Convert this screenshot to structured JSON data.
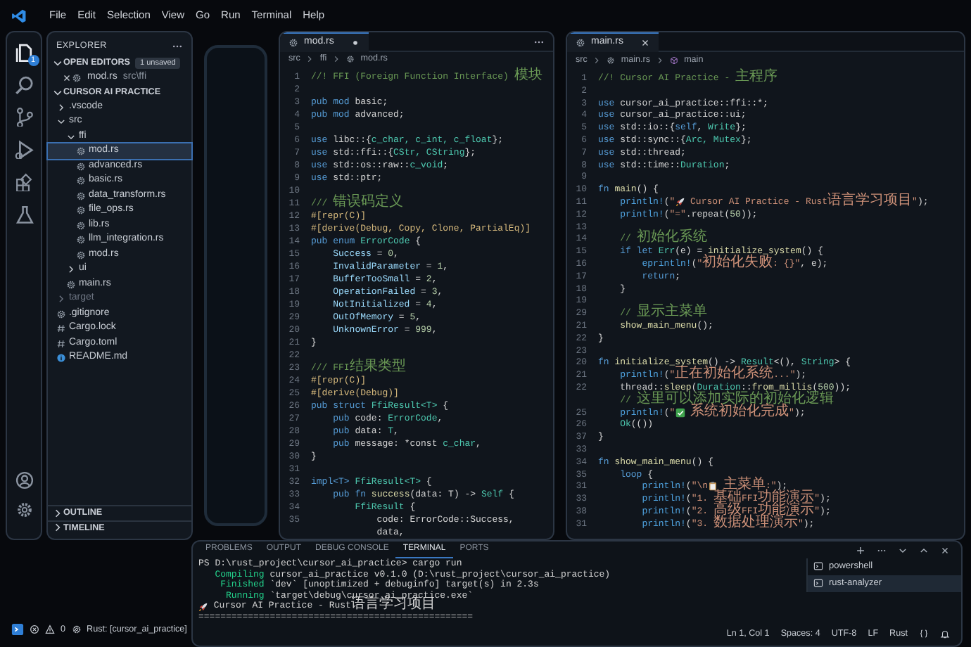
{
  "menu": [
    "File",
    "Edit",
    "Selection",
    "View",
    "Go",
    "Run",
    "Terminal",
    "Help"
  ],
  "activity_bar": {
    "items": [
      {
        "kind": "explorer",
        "selected": true,
        "badge": "1"
      },
      {
        "kind": "search",
        "selected": false
      },
      {
        "kind": "source_control",
        "selected": false
      },
      {
        "kind": "run",
        "selected": false
      },
      {
        "kind": "extensions",
        "selected": false
      },
      {
        "kind": "testing",
        "selected": false
      }
    ],
    "bottom": [
      {
        "kind": "account"
      },
      {
        "kind": "settings"
      }
    ]
  },
  "sidebar": {
    "title": "EXPLORER",
    "open_editors": {
      "title": "OPEN EDITORS",
      "expanded": true,
      "badge": "1 unsaved",
      "items": [
        {
          "label": "mod.rs",
          "path": "src\\ffi",
          "kind": "rust"
        }
      ]
    },
    "project": {
      "title": "CURSOR AI PRACTICE",
      "expanded": true,
      "tree": [
        {
          "label": ".vscode",
          "kind": "folder",
          "expanded": false,
          "selected": false,
          "dimmed": false
        },
        {
          "label": "src",
          "kind": "folder",
          "expanded": true,
          "selected": false,
          "dimmed": false,
          "children": [
            {
              "label": "ffi",
              "kind": "folder",
              "expanded": true,
              "selected": false,
              "dimmed": false,
              "children": [
                {
                  "label": "mod.rs",
                  "kind": "rust",
                  "selected": true,
                  "dimmed": false
                },
                {
                  "label": "advanced.rs",
                  "kind": "rust",
                  "selected": false,
                  "dimmed": false
                },
                {
                  "label": "basic.rs",
                  "kind": "rust",
                  "selected": false,
                  "dimmed": false
                },
                {
                  "label": "data_transform.rs",
                  "kind": "rust",
                  "selected": false,
                  "dimmed": false
                },
                {
                  "label": "file_ops.rs",
                  "kind": "rust",
                  "selected": false,
                  "dimmed": false
                },
                {
                  "label": "lib.rs",
                  "kind": "rust",
                  "selected": false,
                  "dimmed": false
                },
                {
                  "label": "llm_integration.rs",
                  "kind": "rust",
                  "selected": false,
                  "dimmed": false
                },
                {
                  "label": "mod.rs",
                  "kind": "rust",
                  "selected": false,
                  "dimmed": false
                }
              ]
            },
            {
              "label": "ui",
              "kind": "folder",
              "expanded": false,
              "selected": false,
              "dimmed": false
            },
            {
              "label": "main.rs",
              "kind": "rust",
              "selected": false,
              "dimmed": false
            }
          ]
        },
        {
          "label": "target",
          "kind": "folder",
          "expanded": false,
          "selected": false,
          "dimmed": true
        },
        {
          "label": ".gitignore",
          "kind": "git",
          "selected": false,
          "dimmed": false
        },
        {
          "label": "Cargo.lock",
          "kind": "config",
          "selected": false,
          "dimmed": false
        },
        {
          "label": "Cargo.toml",
          "kind": "config",
          "selected": false,
          "dimmed": false
        },
        {
          "label": "README.md",
          "kind": "markdown",
          "selected": false,
          "dimmed": false
        }
      ]
    },
    "sections": [
      {
        "title": "OUTLINE",
        "expanded": false
      },
      {
        "title": "TIMELINE",
        "expanded": false
      }
    ]
  },
  "editors": [
    {
      "tab": {
        "label": "mod.rs",
        "unsaved": true
      },
      "show_more": true,
      "breadcrumb": [
        {
          "label": "src",
          "kind": "folder"
        },
        {
          "label": "ffi",
          "kind": "folder"
        },
        {
          "label": "mod.rs",
          "kind": "rust"
        }
      ],
      "lines": [
        {
          "n": "1",
          "code": [
            {
              "kind": "comment",
              "t": "//! FFI (Foreign Function Interface) 模块"
            }
          ]
        },
        {
          "n": "2"
        },
        {
          "n": "3",
          "code": [
            {
              "kind": "kw",
              "t": "pub mod"
            },
            {
              "kind": "plain",
              "t": " basic;"
            }
          ]
        },
        {
          "n": "4",
          "code": [
            {
              "kind": "kw",
              "t": "pub mod"
            },
            {
              "kind": "plain",
              "t": " advanced;"
            }
          ]
        },
        {
          "n": "5"
        },
        {
          "n": "6",
          "code": [
            {
              "kind": "kw",
              "t": "use"
            },
            {
              "kind": "plain",
              "t": " libc::{"
            },
            {
              "kind": "type",
              "t": "c_char, c_int, c_float"
            },
            {
              "kind": "plain",
              "t": "};"
            }
          ]
        },
        {
          "n": "7",
          "code": [
            {
              "kind": "kw",
              "t": "use"
            },
            {
              "kind": "plain",
              "t": " std::ffi::{"
            },
            {
              "kind": "type",
              "t": "CStr, CString"
            },
            {
              "kind": "plain",
              "t": "};"
            }
          ]
        },
        {
          "n": "8",
          "code": [
            {
              "kind": "kw",
              "t": "use"
            },
            {
              "kind": "plain",
              "t": " std::os::raw::"
            },
            {
              "kind": "type",
              "t": "c_void"
            },
            {
              "kind": "plain",
              "t": ";"
            }
          ]
        },
        {
          "n": "9",
          "code": [
            {
              "kind": "kw",
              "t": "use"
            },
            {
              "kind": "plain",
              "t": " std::ptr;"
            }
          ]
        },
        {
          "n": "10"
        },
        {
          "n": "11",
          "code": [
            {
              "kind": "comment",
              "t": "/// 错误码定义"
            }
          ]
        },
        {
          "n": "12",
          "code": [
            {
              "kind": "attr",
              "t": "#[repr(C)]"
            }
          ]
        },
        {
          "n": "13",
          "code": [
            {
              "kind": "attr",
              "t": "#[derive(Debug, Copy, Clone, PartialEq)]"
            }
          ]
        },
        {
          "n": "14",
          "code": [
            {
              "kind": "kw",
              "t": "pub enum"
            },
            {
              "kind": "type",
              "t": " ErrorCode"
            },
            {
              "kind": "plain",
              "t": " {"
            }
          ]
        },
        {
          "n": "15",
          "code": [
            {
              "kind": "var",
              "t": "    Success"
            },
            {
              "kind": "plain",
              "t": " = "
            },
            {
              "kind": "num",
              "t": "0"
            },
            {
              "kind": "plain",
              "t": ","
            }
          ]
        },
        {
          "n": "16",
          "code": [
            {
              "kind": "var",
              "t": "    InvalidParameter"
            },
            {
              "kind": "plain",
              "t": " = "
            },
            {
              "kind": "num",
              "t": "1"
            },
            {
              "kind": "plain",
              "t": ","
            }
          ]
        },
        {
          "n": "17",
          "code": [
            {
              "kind": "var",
              "t": "    BufferTooSmall"
            },
            {
              "kind": "plain",
              "t": " = "
            },
            {
              "kind": "num",
              "t": "2"
            },
            {
              "kind": "plain",
              "t": ","
            }
          ]
        },
        {
          "n": "18",
          "code": [
            {
              "kind": "var",
              "t": "    OperationFailed"
            },
            {
              "kind": "plain",
              "t": " = "
            },
            {
              "kind": "num",
              "t": "3"
            },
            {
              "kind": "plain",
              "t": ","
            }
          ]
        },
        {
          "n": "19",
          "code": [
            {
              "kind": "var",
              "t": "    NotInitialized"
            },
            {
              "kind": "plain",
              "t": " = "
            },
            {
              "kind": "num",
              "t": "4"
            },
            {
              "kind": "plain",
              "t": ","
            }
          ]
        },
        {
          "n": "29",
          "code": [
            {
              "kind": "var",
              "t": "    OutOfMemory"
            },
            {
              "kind": "plain",
              "t": " = "
            },
            {
              "kind": "num",
              "t": "5"
            },
            {
              "kind": "plain",
              "t": ","
            }
          ]
        },
        {
          "n": "20",
          "code": [
            {
              "kind": "var",
              "t": "    UnknownError"
            },
            {
              "kind": "plain",
              "t": " = "
            },
            {
              "kind": "num",
              "t": "999"
            },
            {
              "kind": "plain",
              "t": ","
            }
          ]
        },
        {
          "n": "21",
          "code": [
            {
              "kind": "plain",
              "t": "}"
            }
          ]
        },
        {
          "n": "22"
        },
        {
          "n": "23",
          "code": [
            {
              "kind": "comment",
              "t": "/// FFI结果类型"
            }
          ]
        },
        {
          "n": "24",
          "code": [
            {
              "kind": "attr",
              "t": "#[repr(C)]"
            }
          ]
        },
        {
          "n": "25",
          "code": [
            {
              "kind": "attr",
              "t": "#[derive(Debug)]"
            }
          ]
        },
        {
          "n": "26",
          "code": [
            {
              "kind": "kw",
              "t": "pub struct"
            },
            {
              "kind": "type",
              "t": " FfiResult<T>"
            },
            {
              "kind": "plain",
              "t": " {"
            }
          ]
        },
        {
          "n": "27",
          "code": [
            {
              "kind": "kw",
              "t": "    pub"
            },
            {
              "kind": "plain",
              "t": " code: "
            },
            {
              "kind": "type",
              "t": "ErrorCode"
            },
            {
              "kind": "plain",
              "t": ","
            }
          ]
        },
        {
          "n": "28",
          "code": [
            {
              "kind": "kw",
              "t": "    pub"
            },
            {
              "kind": "plain",
              "t": " data: "
            },
            {
              "kind": "type",
              "t": "T"
            },
            {
              "kind": "plain",
              "t": ","
            }
          ]
        },
        {
          "n": "29",
          "code": [
            {
              "kind": "kw",
              "t": "    pub"
            },
            {
              "kind": "plain",
              "t": " message: *const "
            },
            {
              "kind": "type",
              "t": "c_char"
            },
            {
              "kind": "plain",
              "t": ","
            }
          ]
        },
        {
          "n": "30",
          "code": [
            {
              "kind": "plain",
              "t": "}"
            }
          ]
        },
        {
          "n": "31"
        },
        {
          "n": "32",
          "code": [
            {
              "kind": "kw",
              "t": "impl<T>"
            },
            {
              "kind": "type",
              "t": " FfiResult<T>"
            },
            {
              "kind": "plain",
              "t": " {"
            }
          ]
        },
        {
          "n": "33",
          "code": [
            {
              "kind": "kw",
              "t": "    pub fn"
            },
            {
              "kind": "fn",
              "t": " success"
            },
            {
              "kind": "plain",
              "t": "(data: T) -> "
            },
            {
              "kind": "type",
              "t": "Self"
            },
            {
              "kind": "plain",
              "t": " {"
            }
          ]
        },
        {
          "n": "34",
          "code": [
            {
              "kind": "type",
              "t": "        FfiResult"
            },
            {
              "kind": "plain",
              "t": " {"
            }
          ]
        },
        {
          "n": "35",
          "code": [
            {
              "kind": "plain",
              "t": "            code: ErrorCode::Success,"
            }
          ]
        },
        {
          "code": [
            {
              "kind": "plain",
              "t": "            data,"
            }
          ]
        }
      ]
    },
    {
      "tab": {
        "label": "main.rs",
        "unsaved": false
      },
      "show_more": false,
      "breadcrumb": [
        {
          "label": "src",
          "kind": "folder"
        },
        {
          "label": "main.rs",
          "kind": "rust"
        },
        {
          "label": "main",
          "kind": "symbol"
        }
      ],
      "lines": [
        {
          "n": "1",
          "code": [
            {
              "kind": "comment",
              "t": "//! Cursor AI Practice - 主程序"
            }
          ]
        },
        {
          "n": "2"
        },
        {
          "n": "3",
          "code": [
            {
              "kind": "kw",
              "t": "use"
            },
            {
              "kind": "plain",
              "t": " cursor_ai_practice::ffi::*;"
            }
          ]
        },
        {
          "n": "4",
          "code": [
            {
              "kind": "kw",
              "t": "use"
            },
            {
              "kind": "plain",
              "t": " cursor_ai_practice::ui;"
            }
          ]
        },
        {
          "n": "5",
          "code": [
            {
              "kind": "kw",
              "t": "use"
            },
            {
              "kind": "plain",
              "t": " std::io::{"
            },
            {
              "kind": "kw",
              "t": "self"
            },
            {
              "kind": "plain",
              "t": ", "
            },
            {
              "kind": "type",
              "t": "Write"
            },
            {
              "kind": "plain",
              "t": "};"
            }
          ]
        },
        {
          "n": "6",
          "code": [
            {
              "kind": "kw",
              "t": "use"
            },
            {
              "kind": "plain",
              "t": " std::sync::{"
            },
            {
              "kind": "type",
              "t": "Arc, Mutex"
            },
            {
              "kind": "plain",
              "t": "};"
            }
          ]
        },
        {
          "n": "7",
          "code": [
            {
              "kind": "kw",
              "t": "use"
            },
            {
              "kind": "plain",
              "t": " std::thread;"
            }
          ]
        },
        {
          "n": "8",
          "code": [
            {
              "kind": "kw",
              "t": "use"
            },
            {
              "kind": "plain",
              "t": " std::time::"
            },
            {
              "kind": "type",
              "t": "Duration"
            },
            {
              "kind": "plain",
              "t": ";"
            }
          ]
        },
        {
          "n": "9"
        },
        {
          "n": "10",
          "code": [
            {
              "kind": "kw",
              "t": "fn"
            },
            {
              "kind": "fn",
              "t": " main"
            },
            {
              "kind": "plain",
              "t": "() {"
            }
          ]
        },
        {
          "n": "11",
          "code": [
            {
              "kind": "macro",
              "t": "    println!"
            },
            {
              "kind": "plain",
              "t": "("
            },
            {
              "kind": "str",
              "t": "\""
            },
            {
              "kind": "rocket"
            },
            {
              "kind": "str",
              "t": " Cursor AI Practice - Rust语言学习项目\""
            },
            {
              "kind": "plain",
              "t": ");"
            }
          ]
        },
        {
          "n": "12",
          "code": [
            {
              "kind": "macro",
              "t": "    println!"
            },
            {
              "kind": "plain",
              "t": "("
            },
            {
              "kind": "str",
              "t": "\"=\""
            },
            {
              "kind": "plain",
              "t": ".repeat("
            },
            {
              "kind": "num",
              "t": "50"
            },
            {
              "kind": "plain",
              "t": "));"
            }
          ]
        },
        {
          "n": "13"
        },
        {
          "n": "14",
          "code": [
            {
              "kind": "comment",
              "t": "    // 初始化系统"
            }
          ]
        },
        {
          "n": "15",
          "code": [
            {
              "kind": "kw",
              "t": "    if let"
            },
            {
              "kind": "type",
              "t": " Err"
            },
            {
              "kind": "plain",
              "t": "(e) = "
            },
            {
              "kind": "fn",
              "t": "initialize_system"
            },
            {
              "kind": "plain",
              "t": "() {"
            }
          ]
        },
        {
          "n": "16",
          "code": [
            {
              "kind": "macro",
              "t": "        eprintln!"
            },
            {
              "kind": "plain",
              "t": "("
            },
            {
              "kind": "str",
              "t": "\"初始化失败: {}\""
            },
            {
              "kind": "plain",
              "t": ", e);"
            }
          ]
        },
        {
          "n": "17",
          "code": [
            {
              "kind": "kw",
              "t": "        return"
            },
            {
              "kind": "plain",
              "t": ";"
            }
          ]
        },
        {
          "n": "18",
          "code": [
            {
              "kind": "plain",
              "t": "    }"
            }
          ]
        },
        {
          "n": "19"
        },
        {
          "n": "29",
          "code": [
            {
              "kind": "comment",
              "t": "    // 显示主菜单"
            }
          ]
        },
        {
          "n": "21",
          "code": [
            {
              "kind": "fn",
              "t": "    show_main_menu"
            },
            {
              "kind": "plain",
              "t": "();"
            }
          ]
        },
        {
          "n": "22",
          "code": [
            {
              "kind": "plain",
              "t": "}"
            }
          ]
        },
        {
          "n": "23"
        },
        {
          "n": "20",
          "code": [
            {
              "kind": "kw",
              "t": "fn"
            },
            {
              "kind": "fn",
              "t": " initialize_system"
            },
            {
              "kind": "plain",
              "t": "() -> "
            },
            {
              "kind": "type",
              "t": "Result"
            },
            {
              "kind": "plain",
              "t": "<(), "
            },
            {
              "kind": "type",
              "t": "String"
            },
            {
              "kind": "plain",
              "t": "> {"
            }
          ]
        },
        {
          "n": "21",
          "code": [
            {
              "kind": "macro",
              "t": "    println!"
            },
            {
              "kind": "plain",
              "t": "("
            },
            {
              "kind": "str",
              "t": "\"正在初始化系统...\""
            },
            {
              "kind": "plain",
              "t": ");"
            }
          ]
        },
        {
          "n": "22",
          "code": [
            {
              "kind": "plain",
              "t": "    thread::"
            },
            {
              "kind": "fn",
              "t": "sleep"
            },
            {
              "kind": "plain",
              "t": "("
            },
            {
              "kind": "type",
              "t": "Duration"
            },
            {
              "kind": "plain",
              "t": "::"
            },
            {
              "kind": "fn",
              "t": "from_millis"
            },
            {
              "kind": "plain",
              "t": "("
            },
            {
              "kind": "num",
              "t": "500"
            },
            {
              "kind": "plain",
              "t": "));"
            }
          ]
        },
        {
          "code": [
            {
              "kind": "comment",
              "t": "    // 这里可以添加实际的初始化逻辑"
            }
          ]
        },
        {
          "n": "25",
          "code": [
            {
              "kind": "macro",
              "t": "    println!"
            },
            {
              "kind": "plain",
              "t": "("
            },
            {
              "kind": "str",
              "t": "\""
            },
            {
              "kind": "check"
            },
            {
              "kind": "str",
              "t": " 系统初始化完成\""
            },
            {
              "kind": "plain",
              "t": ");"
            }
          ]
        },
        {
          "n": "26",
          "code": [
            {
              "kind": "type",
              "t": "    Ok"
            },
            {
              "kind": "plain",
              "t": "(())"
            }
          ]
        },
        {
          "n": "37",
          "code": [
            {
              "kind": "plain",
              "t": "}"
            }
          ]
        },
        {
          "n": "33"
        },
        {
          "n": "34",
          "code": [
            {
              "kind": "kw",
              "t": "fn"
            },
            {
              "kind": "fn",
              "t": " show_main_menu"
            },
            {
              "kind": "plain",
              "t": "() {"
            }
          ]
        },
        {
          "n": "35",
          "code": [
            {
              "kind": "kw",
              "t": "    loop"
            },
            {
              "kind": "plain",
              "t": " {"
            }
          ]
        },
        {
          "n": "31",
          "code": [
            {
              "kind": "macro",
              "t": "        println!"
            },
            {
              "kind": "plain",
              "t": "("
            },
            {
              "kind": "str",
              "t": "\"\\n"
            },
            {
              "kind": "clipboard"
            },
            {
              "kind": "str",
              "t": " 主菜单:\""
            },
            {
              "kind": "plain",
              "t": ");"
            }
          ]
        },
        {
          "n": "33",
          "code": [
            {
              "kind": "macro",
              "t": "        println!"
            },
            {
              "kind": "plain",
              "t": "("
            },
            {
              "kind": "str",
              "t": "\"1. 基础FFI功能演示\""
            },
            {
              "kind": "plain",
              "t": ");"
            }
          ]
        },
        {
          "n": "38",
          "code": [
            {
              "kind": "macro",
              "t": "        println!"
            },
            {
              "kind": "plain",
              "t": "("
            },
            {
              "kind": "str",
              "t": "\"2. 高级FFI功能演示\""
            },
            {
              "kind": "plain",
              "t": ");"
            }
          ]
        },
        {
          "n": "31",
          "code": [
            {
              "kind": "macro",
              "t": "        println!"
            },
            {
              "kind": "plain",
              "t": "("
            },
            {
              "kind": "str",
              "t": "\"3. 数据处理演示\""
            },
            {
              "kind": "plain",
              "t": ");"
            }
          ]
        }
      ]
    }
  ],
  "panel": {
    "tabs": [
      {
        "label": "PROBLEMS",
        "selected": false
      },
      {
        "label": "OUTPUT",
        "selected": false
      },
      {
        "label": "DEBUG CONSOLE",
        "selected": false
      },
      {
        "label": "TERMINAL",
        "selected": true
      },
      {
        "label": "PORTS",
        "selected": false
      }
    ],
    "lines": [
      [
        {
          "kind": "plain",
          "t": "PS D:\\rust_project\\cursor_ai_practice> cargo run"
        }
      ],
      [
        {
          "kind": "green",
          "t": "   Compiling"
        },
        {
          "kind": "plain",
          "t": " cursor_ai_practice v0.1.0 (D:\\rust_project\\cursor_ai_practice)"
        }
      ],
      [
        {
          "kind": "green",
          "t": "    Finished"
        },
        {
          "kind": "plain",
          "t": " `dev` [unoptimized + debuginfo] target(s) in 2.3s"
        }
      ],
      [
        {
          "kind": "green",
          "t": "     Running"
        },
        {
          "kind": "plain",
          "t": " `target\\debug\\cursor_ai_practice.exe`"
        }
      ],
      [
        {
          "kind": "rocket"
        },
        {
          "kind": "plain",
          "t": " Cursor AI Practice - Rust语言学习项目"
        }
      ],
      [
        {
          "kind": "plain",
          "t": "=================================================="
        }
      ]
    ],
    "sessions": [
      {
        "label": "powershell",
        "selected": false
      },
      {
        "label": "rust-analyzer",
        "selected": true
      }
    ]
  },
  "status_bar": {
    "problems": "0",
    "rust": "Rust: [cursor_ai_practice]",
    "position": "Ln 1, Col 1",
    "indent": "Spaces: 4",
    "encoding": "UTF-8",
    "eol": "LF",
    "language": "Rust"
  }
}
